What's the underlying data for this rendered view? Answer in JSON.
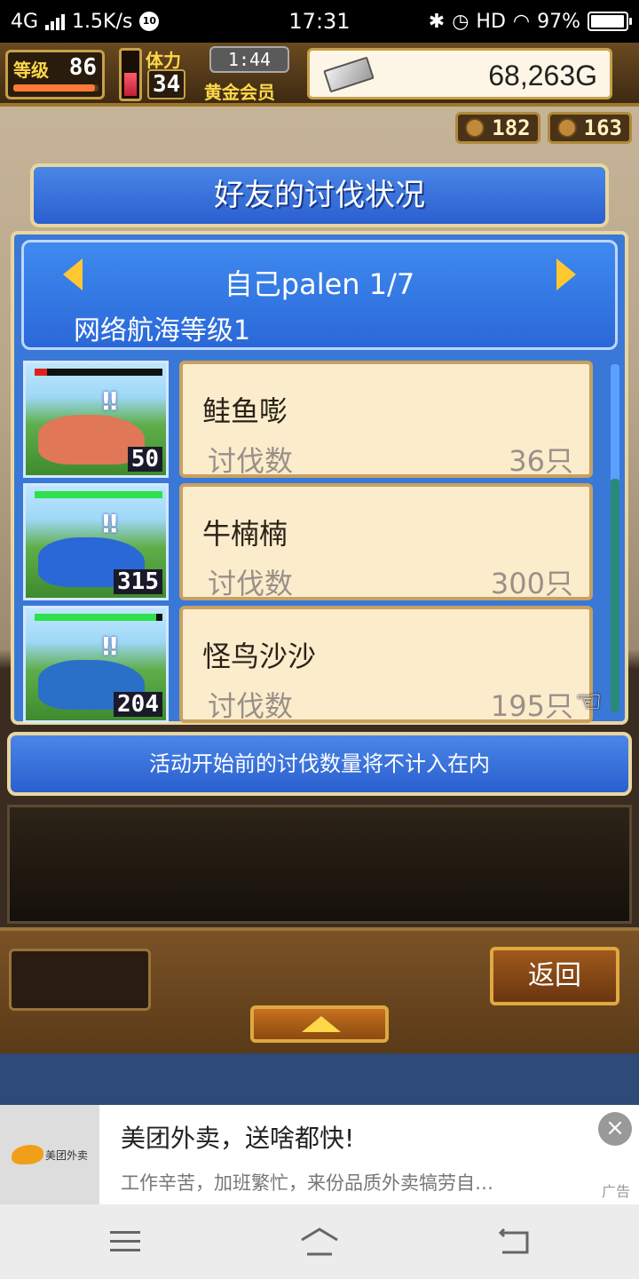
{
  "status_bar": {
    "network": "4G",
    "speed": "1.5K/s",
    "badge": "10",
    "time": "17:31",
    "hd": "HD",
    "battery": "97%",
    "battery_level": 0.97
  },
  "hud": {
    "level_label": "等级",
    "level": "86",
    "level_progress": 0.96,
    "stamina_label": "体力",
    "stamina": "34",
    "stamina_level": 0.55,
    "timer": "1:44",
    "membership": "黄金会员",
    "gold": "68,263G",
    "resource1": "182",
    "resource2": "163"
  },
  "title": "好友的讨伐状况",
  "header": {
    "friend_name": "自己palen 1/7",
    "rank": "网络航海等级1"
  },
  "rows": [
    {
      "name": "鲑鱼嘭",
      "label": "讨伐数",
      "count": "36只",
      "level": "50",
      "hp": 0.1,
      "color": "#e07858"
    },
    {
      "name": "牛楠楠",
      "label": "讨伐数",
      "count": "300只",
      "level": "315",
      "hp": 1.0,
      "color": "#2a68d8"
    },
    {
      "name": "怪鸟沙沙",
      "label": "讨伐数",
      "count": "195只",
      "level": "204",
      "hp": 0.95,
      "color": "#2a70c8"
    }
  ],
  "scroll_position": 0.33,
  "note": "活动开始前的讨伐数量将不计入在内",
  "buttons": {
    "back": "返回"
  },
  "ad": {
    "brand": "美团外卖",
    "title": "美团外卖，送啥都快!",
    "description": "工作辛苦，加班繁忙，来份品质外卖犒劳自…",
    "tag": "广告",
    "close": "×"
  }
}
